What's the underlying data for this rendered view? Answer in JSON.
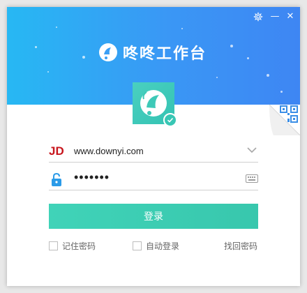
{
  "app": {
    "title": "咚咚工作台"
  },
  "window_controls": {
    "settings_icon": "gear-icon",
    "minimize_label": "—",
    "close_label": "✕"
  },
  "account": {
    "prefix_logo": "JD",
    "value": "www.downyi.com",
    "dropdown_icon": "chevron-down-icon"
  },
  "password": {
    "value": "•••••••",
    "lock_icon": "unlock-icon",
    "keyboard_icon": "keyboard-icon"
  },
  "login_button": {
    "label": "登录"
  },
  "options": {
    "remember_password": "记住密码",
    "auto_login": "自动登录",
    "forgot_password": "找回密码"
  },
  "colors": {
    "header_start": "#27b8f3",
    "header_end": "#3e86f3",
    "accent": "#3cccb2",
    "jd_red": "#c8161d"
  }
}
